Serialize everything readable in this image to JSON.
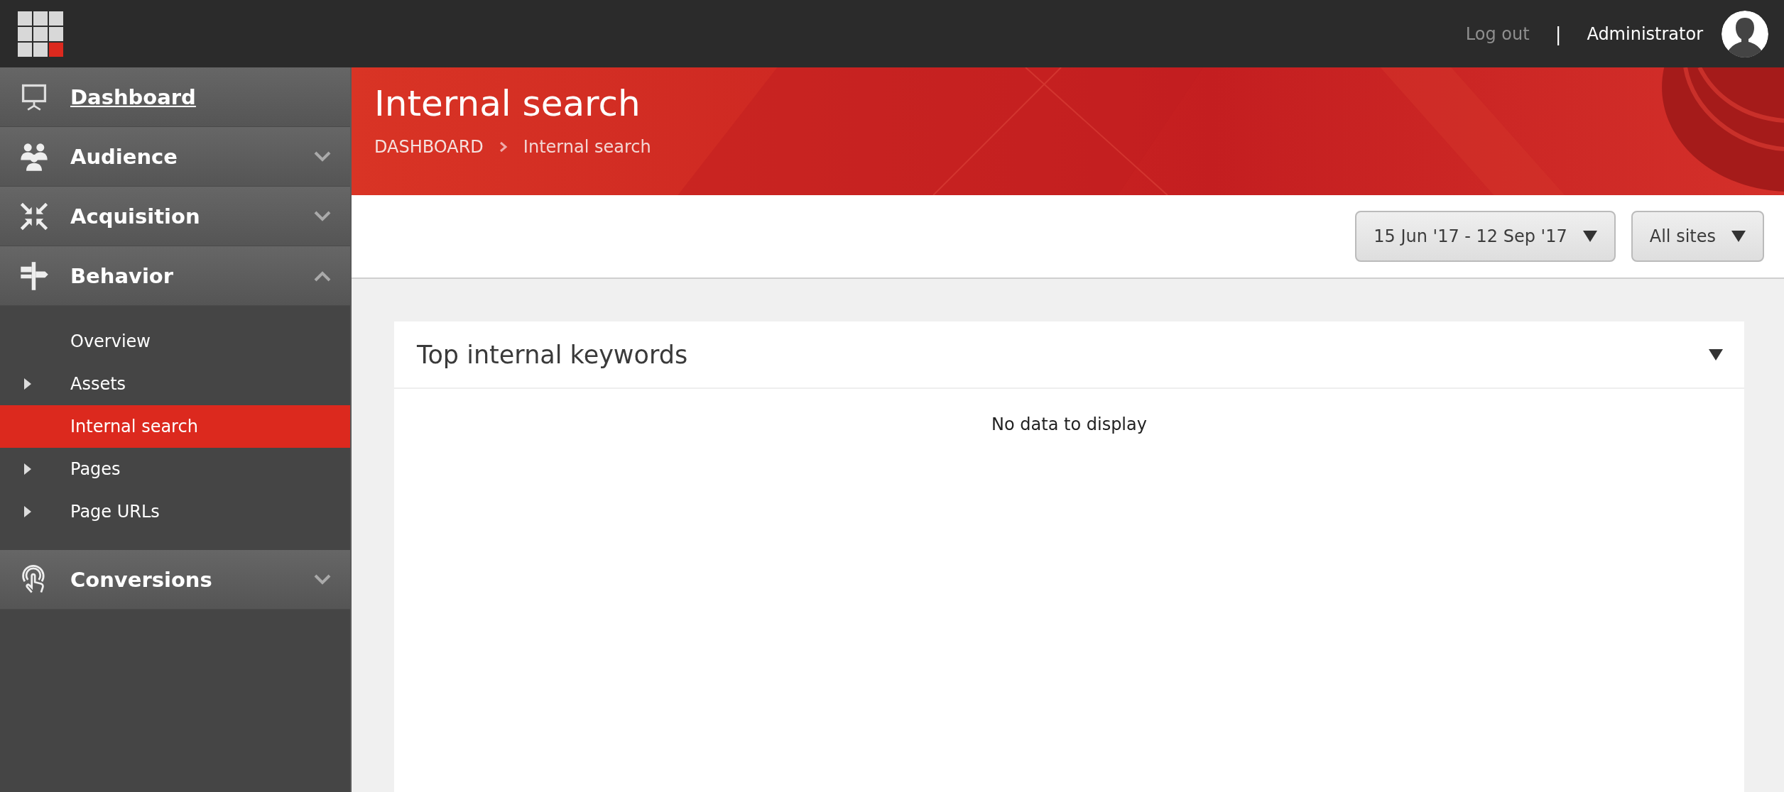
{
  "top_bar": {
    "logout": "Log out",
    "separator": "|",
    "user": "Administrator"
  },
  "sidebar": {
    "items": [
      {
        "label": "Dashboard",
        "kind": "link"
      },
      {
        "label": "Audience",
        "kind": "group",
        "expanded": false
      },
      {
        "label": "Acquisition",
        "kind": "group",
        "expanded": false
      },
      {
        "label": "Behavior",
        "kind": "group",
        "expanded": true,
        "children": [
          {
            "label": "Overview",
            "kind": "leaf",
            "selected": false
          },
          {
            "label": "Assets",
            "kind": "branch",
            "selected": false
          },
          {
            "label": "Internal search",
            "kind": "leaf",
            "selected": true
          },
          {
            "label": "Pages",
            "kind": "branch",
            "selected": false
          },
          {
            "label": "Page URLs",
            "kind": "branch",
            "selected": false
          }
        ]
      },
      {
        "label": "Conversions",
        "kind": "group",
        "expanded": false
      }
    ]
  },
  "banner": {
    "title": "Internal search",
    "breadcrumb": [
      "DASHBOARD",
      "Internal search"
    ]
  },
  "filters": [
    {
      "label": "15 Jun '17 - 12 Sep '17"
    },
    {
      "label": "All sites"
    }
  ],
  "card": {
    "title": "Top internal keywords",
    "message": "No data to display"
  }
}
